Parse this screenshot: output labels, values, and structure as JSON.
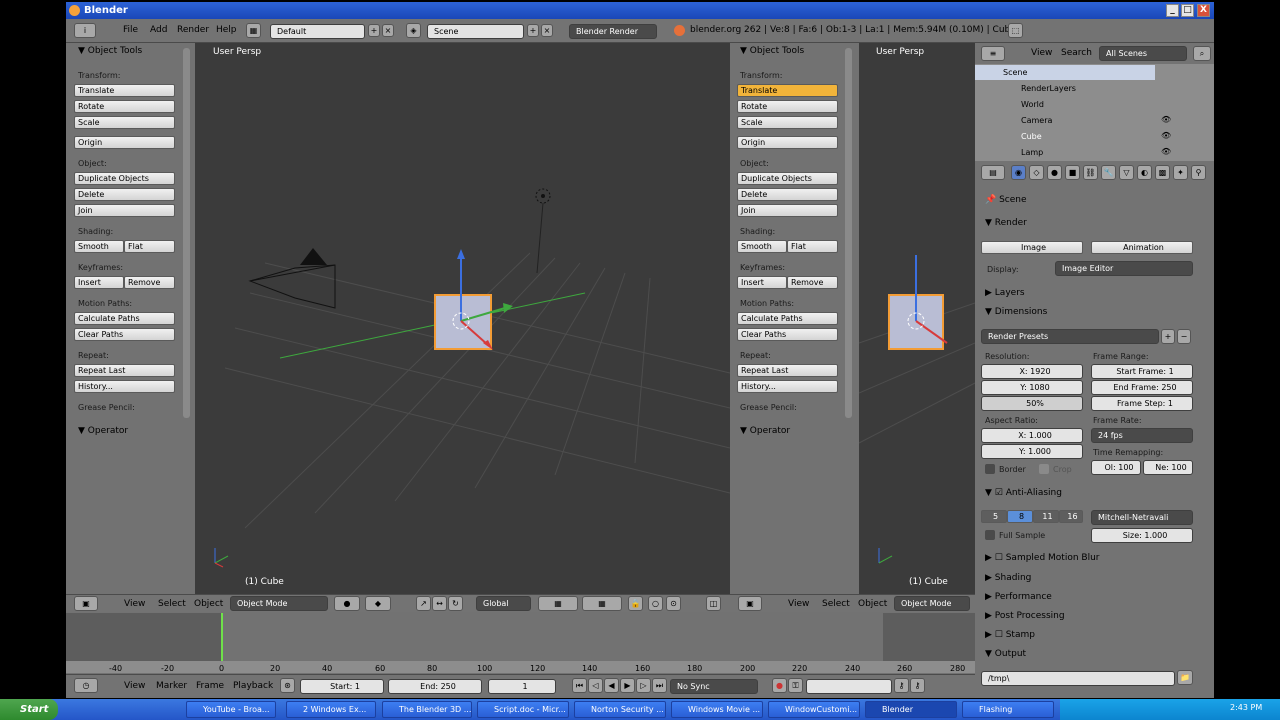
{
  "window": {
    "title": "Blender",
    "close": "X",
    "min": "_",
    "max": "□"
  },
  "infobar": {
    "menus": [
      "File",
      "Add",
      "Render",
      "Help"
    ],
    "layout": "Default",
    "scene": "Scene",
    "engine": "Blender Render",
    "stats": "blender.org 262 | Ve:8 | Fa:6 | Ob:1-3 | La:1 | Mem:5.94M (0.10M) | Cube"
  },
  "toolshelf": {
    "title": "Object Tools",
    "transform": "Transform:",
    "translate": "Translate",
    "rotate": "Rotate",
    "scale": "Scale",
    "origin": "Origin",
    "object": "Object:",
    "duplicate": "Duplicate Objects",
    "delete": "Delete",
    "join": "Join",
    "shading": "Shading:",
    "smooth": "Smooth",
    "flat": "Flat",
    "keyframes": "Keyframes:",
    "insert": "Insert",
    "remove": "Remove",
    "motion_paths": "Motion Paths:",
    "calc_paths": "Calculate Paths",
    "clear_paths": "Clear Paths",
    "repeat": "Repeat:",
    "repeat_last": "Repeat Last",
    "history": "History...",
    "grease_pencil": "Grease Pencil:",
    "operator": "Operator"
  },
  "viewport": {
    "label": "User Persp",
    "object": "(1) Cube"
  },
  "view3d_header": {
    "view": "View",
    "select": "Select",
    "object": "Object",
    "mode": "Object Mode",
    "orientation": "Global"
  },
  "outliner": {
    "view": "View",
    "search": "Search",
    "filter": "All Scenes",
    "items": [
      "Scene",
      "RenderLayers",
      "World",
      "Camera",
      "Cube",
      "Lamp"
    ]
  },
  "properties": {
    "context": "Scene",
    "render": "Render",
    "image": "Image",
    "animation": "Animation",
    "display_label": "Display:",
    "display_value": "Image Editor",
    "layers": "Layers",
    "dimensions": "Dimensions",
    "presets": "Render Presets",
    "resolution": "Resolution:",
    "res_x": "X: 1920",
    "res_y": "Y: 1080",
    "res_pct": "50%",
    "frame_range": "Frame Range:",
    "start_frame": "Start Frame: 1",
    "end_frame": "End Frame: 250",
    "frame_step": "Frame Step: 1",
    "aspect": "Aspect Ratio:",
    "asp_x": "X: 1.000",
    "asp_y": "Y: 1.000",
    "frame_rate": "Frame Rate:",
    "fps": "24 fps",
    "time_remap": "Time Remapping:",
    "old": "Ol: 100",
    "new": "Ne: 100",
    "border": "Border",
    "crop": "Crop",
    "aa": "Anti-Aliasing",
    "aa_opts": [
      "5",
      "8",
      "11",
      "16"
    ],
    "filter": "Mitchell-Netravali",
    "full_sample": "Full Sample",
    "size": "Size: 1.000",
    "motion_blur": "Sampled Motion Blur",
    "shading": "Shading",
    "performance": "Performance",
    "post": "Post Processing",
    "stamp": "Stamp",
    "output": "Output",
    "path": "/tmp\\"
  },
  "timeline": {
    "ticks": [
      "-40",
      "-20",
      "0",
      "20",
      "40",
      "60",
      "80",
      "100",
      "120",
      "140",
      "160",
      "180",
      "200",
      "220",
      "240",
      "260",
      "280"
    ],
    "view": "View",
    "marker": "Marker",
    "frame": "Frame",
    "playback": "Playback",
    "start": "Start: 1",
    "end": "End: 250",
    "current": "1",
    "sync": "No Sync"
  },
  "taskbar": {
    "start": "Start",
    "tasks": [
      "YouTube - Broa...",
      "2 Windows Ex...",
      "The Blender 3D ...",
      "Script.doc - Micr...",
      "Norton Security ...",
      "Windows Movie ...",
      "WindowCustomi...",
      "Blender",
      "Flashing"
    ],
    "clock": "2:43 PM"
  }
}
